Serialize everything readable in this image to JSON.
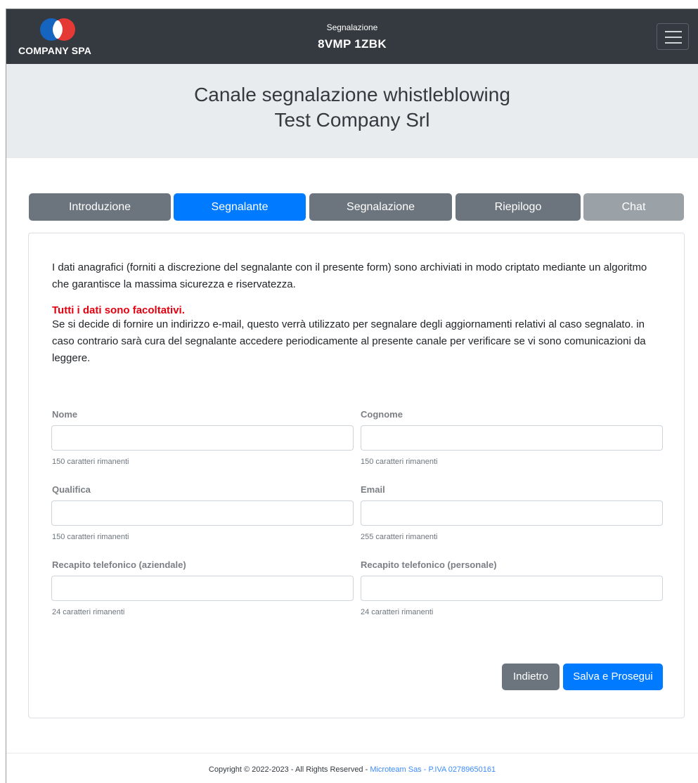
{
  "header": {
    "logo_text": "COMPANY SPA",
    "case_label": "Segnalazione",
    "case_code": "8VMP 1ZBK",
    "menu_icon": "hamburger-icon"
  },
  "hero": {
    "line1": "Canale segnalazione whistleblowing",
    "line2": "Test Company Srl"
  },
  "tabs": [
    {
      "label": "Introduzione",
      "state": "inactive"
    },
    {
      "label": "Segnalante",
      "state": "active"
    },
    {
      "label": "Segnalazione",
      "state": "inactive"
    },
    {
      "label": "Riepilogo",
      "state": "inactive"
    },
    {
      "label": "Chat",
      "state": "disabled"
    }
  ],
  "intro": {
    "paragraph1": "I dati anagrafici (forniti a discrezione del segnalante con il presente form) sono archiviati in modo criptato mediante un algoritmo che garantisce la massima sicurezza e riservatezza.",
    "warning": "Tutti i dati sono facoltativi.",
    "paragraph2": "Se si decide di fornire un indirizzo e-mail, questo verrà utilizzato per segnalare degli aggiornamenti relativi al caso segnalato. in caso contrario sarà cura del segnalante accedere periodicamente al presente canale per verificare se vi sono comunicazioni da leggere."
  },
  "form": {
    "nome": {
      "label": "Nome",
      "value": "",
      "hint": "150 caratteri rimanenti"
    },
    "cognome": {
      "label": "Cognome",
      "value": "",
      "hint": "150 caratteri rimanenti"
    },
    "qualifica": {
      "label": "Qualifica",
      "value": "",
      "hint": "150 caratteri rimanenti"
    },
    "email": {
      "label": "Email",
      "value": "",
      "hint": "255 caratteri rimanenti"
    },
    "tel_aziendale": {
      "label": "Recapito telefonico (aziendale)",
      "value": "",
      "hint": "24 caratteri rimanenti"
    },
    "tel_personale": {
      "label": "Recapito telefonico (personale)",
      "value": "",
      "hint": "24 caratteri rimanenti"
    }
  },
  "actions": {
    "back_label": "Indietro",
    "save_label": "Salva e Prosegui"
  },
  "footer": {
    "copyright": "Copyright © 2022-2023 - All Rights Reserved - ",
    "link": "Microteam Sas - P.IVA 02789650161"
  },
  "colors": {
    "topbar": "#343a40",
    "primary": "#007bff",
    "secondary": "#6c757d",
    "warning_red": "#e3000f",
    "hero_bg": "#e9ecef"
  }
}
